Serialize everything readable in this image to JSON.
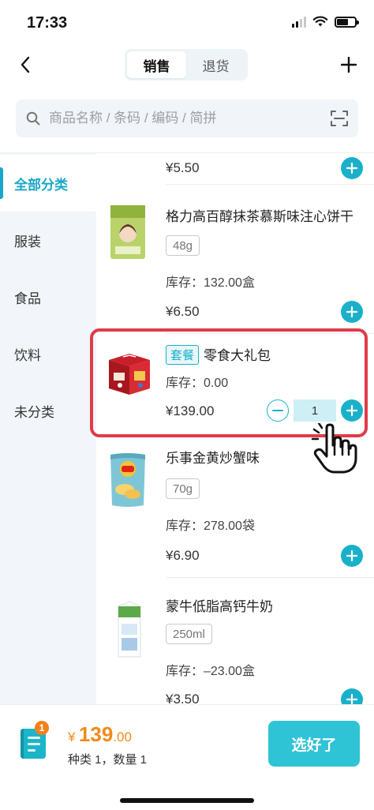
{
  "status_bar": {
    "time": "17:33"
  },
  "nav": {
    "tabs": [
      {
        "label": "销售",
        "active": true
      },
      {
        "label": "退货",
        "active": false
      }
    ]
  },
  "search": {
    "placeholder": "商品名称 / 条码 / 编码 / 简拼"
  },
  "categories": [
    {
      "label": "全部分类",
      "active": true
    },
    {
      "label": "服装",
      "active": false
    },
    {
      "label": "食品",
      "active": false
    },
    {
      "label": "饮料",
      "active": false
    },
    {
      "label": "未分类",
      "active": false
    }
  ],
  "products": [
    {
      "price": "¥5.50"
    },
    {
      "name": "格力高百醇抹茶慕斯味注心饼干",
      "spec": "48g",
      "stock": "库存：132.00盒",
      "price": "¥6.50"
    },
    {
      "combo_tag": "套餐",
      "name": "零食大礼包",
      "stock": "库存：0.00",
      "price": "¥139.00",
      "quantity": "1"
    },
    {
      "name": "乐事金黄炒蟹味",
      "spec": "70g",
      "stock": "库存：278.00袋",
      "price": "¥6.90"
    },
    {
      "name": "蒙牛低脂高钙牛奶",
      "spec": "250ml",
      "stock": "库存：–23.00盒",
      "price": "¥3.50"
    }
  ],
  "cart": {
    "badge": "1",
    "currency": "¥",
    "total_int": "139",
    "total_dec": ".00",
    "summary": "种类 1，数量 1",
    "confirm_label": "选好了"
  },
  "colors": {
    "accent": "#19b1c9",
    "highlight": "#e03b4a",
    "price_orange": "#f08a1c"
  },
  "icons": [
    "back-icon",
    "add-icon",
    "search-icon",
    "scan-icon",
    "plus-icon",
    "minus-icon",
    "cart-icon",
    "hand-pointer-icon"
  ]
}
